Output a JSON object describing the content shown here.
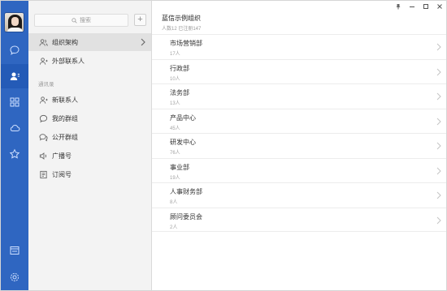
{
  "search": {
    "placeholder": "搜索"
  },
  "add_label": "+",
  "nav": {
    "items_top": [
      {
        "label": "组织架构",
        "icon": "org-chart-icon",
        "active": true
      },
      {
        "label": "外部联系人",
        "icon": "external-contact-icon",
        "active": false
      }
    ],
    "section_title": "通讯录",
    "items_contacts": [
      {
        "label": "新联系人",
        "icon": "new-contact-icon"
      },
      {
        "label": "我的群组",
        "icon": "my-groups-icon"
      },
      {
        "label": "公开群组",
        "icon": "public-groups-icon"
      },
      {
        "label": "广播号",
        "icon": "broadcast-icon"
      },
      {
        "label": "订阅号",
        "icon": "subscription-icon"
      }
    ]
  },
  "rail": {
    "icons": [
      "chat-icon",
      "contacts-icon",
      "apps-icon",
      "cloud-icon",
      "favorites-icon",
      "message-box-icon",
      "settings-icon"
    ],
    "active": "contacts-icon",
    "color": "#2f66c1"
  },
  "org": {
    "title": "蓝信示例组织",
    "subtitle": "人数12 已注册147"
  },
  "departments": [
    {
      "name": "市场营销部",
      "count": "17人"
    },
    {
      "name": "行政部",
      "count": "10人"
    },
    {
      "name": "法务部",
      "count": "13人"
    },
    {
      "name": "产品中心",
      "count": "45人"
    },
    {
      "name": "研发中心",
      "count": "76人"
    },
    {
      "name": "事业部",
      "count": "19人"
    },
    {
      "name": "人事财务部",
      "count": "8人"
    },
    {
      "name": "顾问委员会",
      "count": "2人"
    }
  ],
  "window_controls": [
    "pin-icon",
    "minimize-icon",
    "maximize-icon",
    "close-icon"
  ]
}
